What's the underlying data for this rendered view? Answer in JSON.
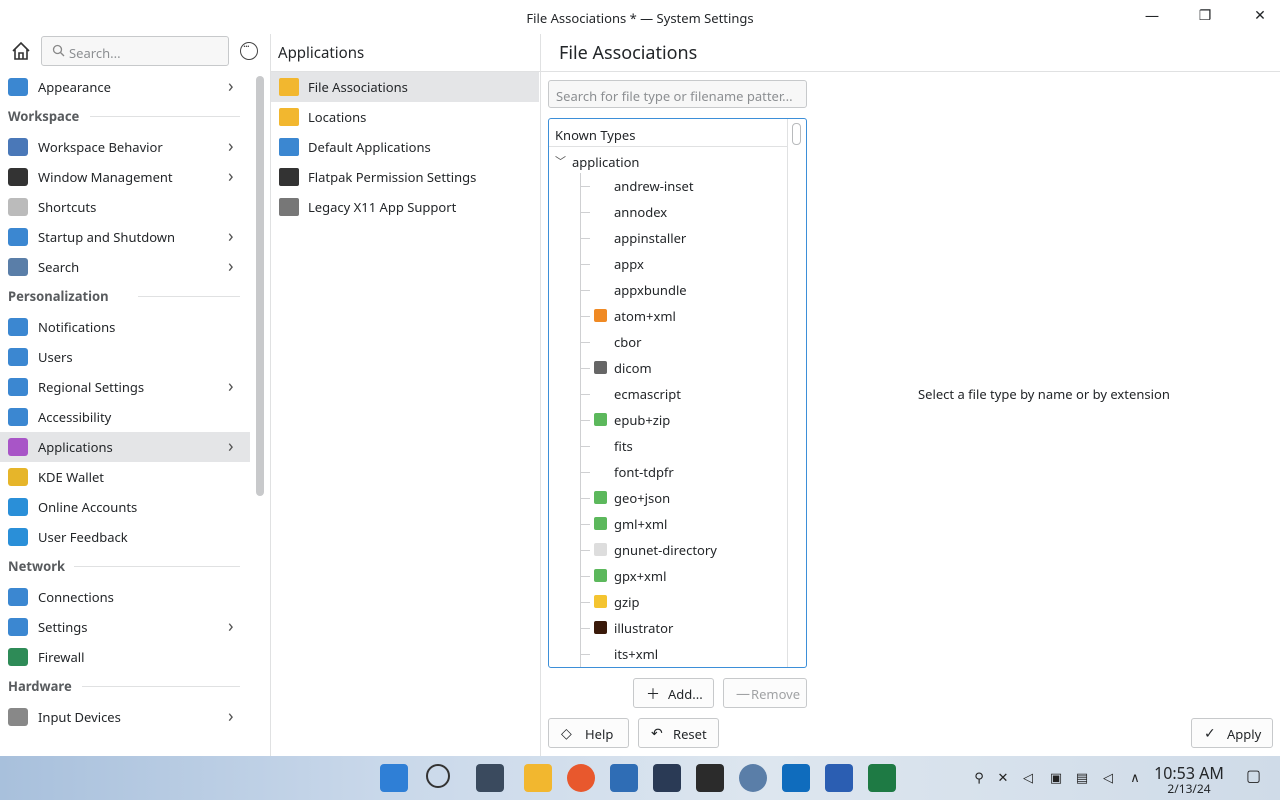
{
  "window": {
    "title": "File Associations * — System Settings"
  },
  "sidebar": {
    "search_placeholder": "Search...",
    "items": [
      {
        "label": "Appearance",
        "chevron": true
      },
      {
        "section": "Workspace"
      },
      {
        "label": "Workspace Behavior",
        "chevron": true
      },
      {
        "label": "Window Management",
        "chevron": true
      },
      {
        "label": "Shortcuts",
        "chevron": false
      },
      {
        "label": "Startup and Shutdown",
        "chevron": true
      },
      {
        "label": "Search",
        "chevron": true
      },
      {
        "section": "Personalization"
      },
      {
        "label": "Notifications",
        "chevron": false
      },
      {
        "label": "Users",
        "chevron": false
      },
      {
        "label": "Regional Settings",
        "chevron": true
      },
      {
        "label": "Accessibility",
        "chevron": false
      },
      {
        "label": "Applications",
        "chevron": true,
        "active": true
      },
      {
        "label": "KDE Wallet",
        "chevron": false
      },
      {
        "label": "Online Accounts",
        "chevron": false
      },
      {
        "label": "User Feedback",
        "chevron": false
      },
      {
        "section": "Network"
      },
      {
        "label": "Connections",
        "chevron": false
      },
      {
        "label": "Settings",
        "chevron": true
      },
      {
        "label": "Firewall",
        "chevron": false
      },
      {
        "section": "Hardware"
      },
      {
        "label": "Input Devices",
        "chevron": true
      }
    ]
  },
  "applications_panel": {
    "title": "Applications",
    "items": [
      {
        "label": "File Associations",
        "active": true
      },
      {
        "label": "Locations"
      },
      {
        "label": "Default Applications"
      },
      {
        "label": "Flatpak Permission Settings"
      },
      {
        "label": "Legacy X11 App Support"
      }
    ]
  },
  "main": {
    "title": "File Associations",
    "search_placeholder": "Search for file type or filename patter...",
    "tree_header": "Known Types",
    "root": "application",
    "types": [
      "andrew-inset",
      "annodex",
      "appinstaller",
      "appx",
      "appxbundle",
      "atom+xml",
      "cbor",
      "dicom",
      "ecmascript",
      "epub+zip",
      "fits",
      "font-tdpfr",
      "geo+json",
      "gml+xml",
      "gnunet-directory",
      "gpx+xml",
      "gzip",
      "illustrator",
      "its+xml"
    ],
    "add_label": "Add...",
    "remove_label": "Remove",
    "placeholder_text": "Select a file type by name or by extension",
    "help_label": "Help",
    "reset_label": "Reset",
    "apply_label": "Apply"
  },
  "taskbar": {
    "time": "10:53 AM",
    "date": "2/13/24"
  },
  "colors": {
    "accent": "#3d8fd8",
    "selection": "#e4e5e7"
  }
}
